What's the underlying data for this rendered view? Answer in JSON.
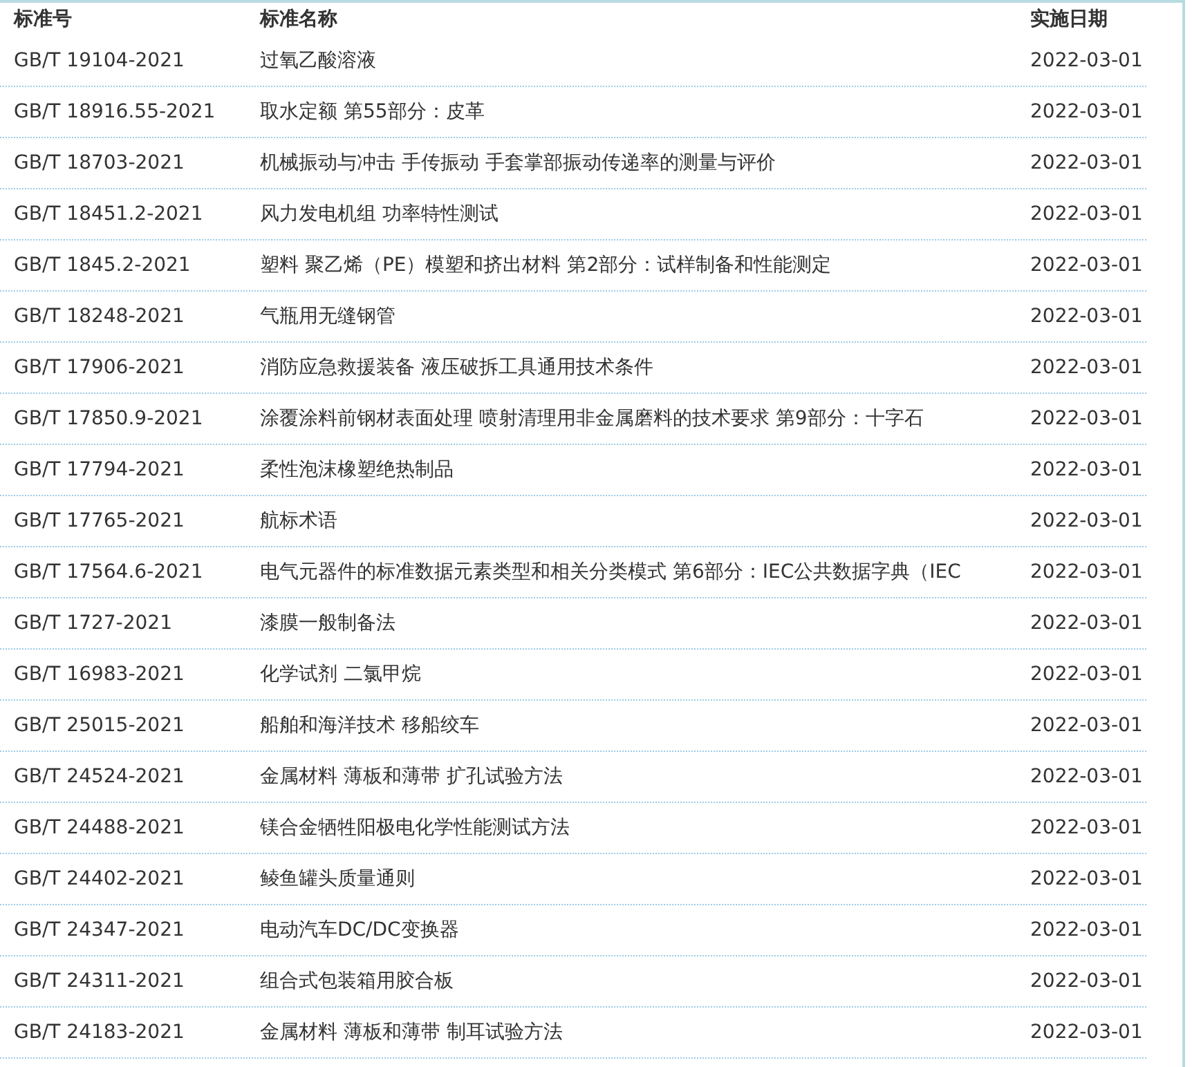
{
  "table": {
    "columns": [
      "标准号",
      "标准名称",
      "实施日期"
    ],
    "rows": [
      [
        "GB/T 19104-2021",
        "过氧乙酸溶液",
        "2022-03-01"
      ],
      [
        "GB/T 18916.55-2021",
        "取水定额 第55部分：皮革",
        "2022-03-01"
      ],
      [
        "GB/T 18703-2021",
        "机械振动与冲击 手传振动 手套掌部振动传递率的测量与评价",
        "2022-03-01"
      ],
      [
        "GB/T 18451.2-2021",
        "风力发电机组 功率特性测试",
        "2022-03-01"
      ],
      [
        "GB/T 1845.2-2021",
        "塑料 聚乙烯（PE）模塑和挤出材料 第2部分：试样制备和性能测定",
        "2022-03-01"
      ],
      [
        "GB/T 18248-2021",
        "气瓶用无缝钢管",
        "2022-03-01"
      ],
      [
        "GB/T 17906-2021",
        "消防应急救援装备 液压破拆工具通用技术条件",
        "2022-03-01"
      ],
      [
        "GB/T 17850.9-2021",
        "涂覆涂料前钢材表面处理 喷射清理用非金属磨料的技术要求 第9部分：十字石",
        "2022-03-01"
      ],
      [
        "GB/T 17794-2021",
        "柔性泡沫橡塑绝热制品",
        "2022-03-01"
      ],
      [
        "GB/T 17765-2021",
        "航标术语",
        "2022-03-01"
      ],
      [
        "GB/T 17564.6-2021",
        "电气元器件的标准数据元素类型和相关分类模式 第6部分：IEC公共数据字典（IEC",
        "2022-03-01"
      ],
      [
        "GB/T 1727-2021",
        "漆膜一般制备法",
        "2022-03-01"
      ],
      [
        "GB/T 16983-2021",
        "化学试剂 二氯甲烷",
        "2022-03-01"
      ],
      [
        "GB/T 25015-2021",
        "船舶和海洋技术 移船绞车",
        "2022-03-01"
      ],
      [
        "GB/T 24524-2021",
        "金属材料 薄板和薄带 扩孔试验方法",
        "2022-03-01"
      ],
      [
        "GB/T 24488-2021",
        "镁合金牺牲阳极电化学性能测试方法",
        "2022-03-01"
      ],
      [
        "GB/T 24402-2021",
        "鲮鱼罐头质量通则",
        "2022-03-01"
      ],
      [
        "GB/T 24347-2021",
        "电动汽车DC/DC变换器",
        "2022-03-01"
      ],
      [
        "GB/T 24311-2021",
        "组合式包装箱用胶合板",
        "2022-03-01"
      ],
      [
        "GB/T 24183-2021",
        "金属材料 薄板和薄带 制耳试验方法",
        "2022-03-01"
      ]
    ]
  }
}
